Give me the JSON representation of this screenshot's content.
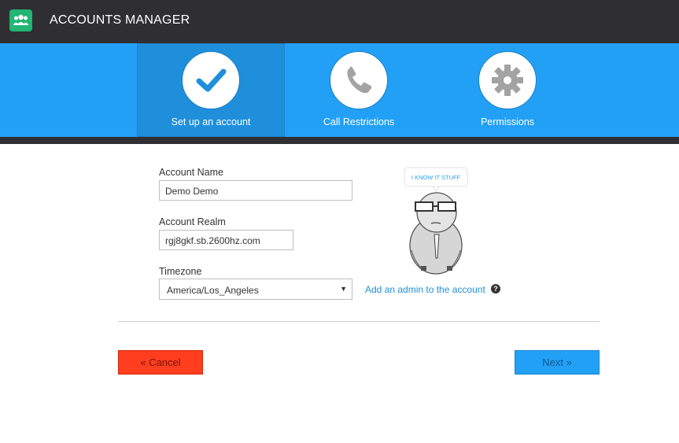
{
  "header": {
    "app_title": "ACCOUNTS MANAGER",
    "app_icon": "users-icon"
  },
  "steps": [
    {
      "label": "Set up an account",
      "icon": "checkmark-icon",
      "active": true
    },
    {
      "label": "Call Restrictions",
      "icon": "phone-icon",
      "active": false
    },
    {
      "label": "Permissions",
      "icon": "gear-icon",
      "active": false
    }
  ],
  "form": {
    "account_name_label": "Account Name",
    "account_name_value": "Demo Demo",
    "account_realm_label": "Account Realm",
    "account_realm_value": "rgj8gkf.sb.2600hz.com",
    "timezone_label": "Timezone",
    "timezone_value": "America/Los_Angeles"
  },
  "sidebar": {
    "speech_bubble": "I KNOW IT STUFF",
    "admin_link": "Add an admin to the account",
    "help_icon": "question-circle-icon"
  },
  "buttons": {
    "cancel": "Cancel",
    "next": "Next"
  },
  "colors": {
    "topbar": "#2f2f33",
    "steps_bar": "#22a0f5",
    "active_step": "#1f8fdc",
    "app_icon": "#22b573",
    "cancel": "#ff3d1f",
    "next": "#22a0f5",
    "link": "#1f8fdc"
  }
}
